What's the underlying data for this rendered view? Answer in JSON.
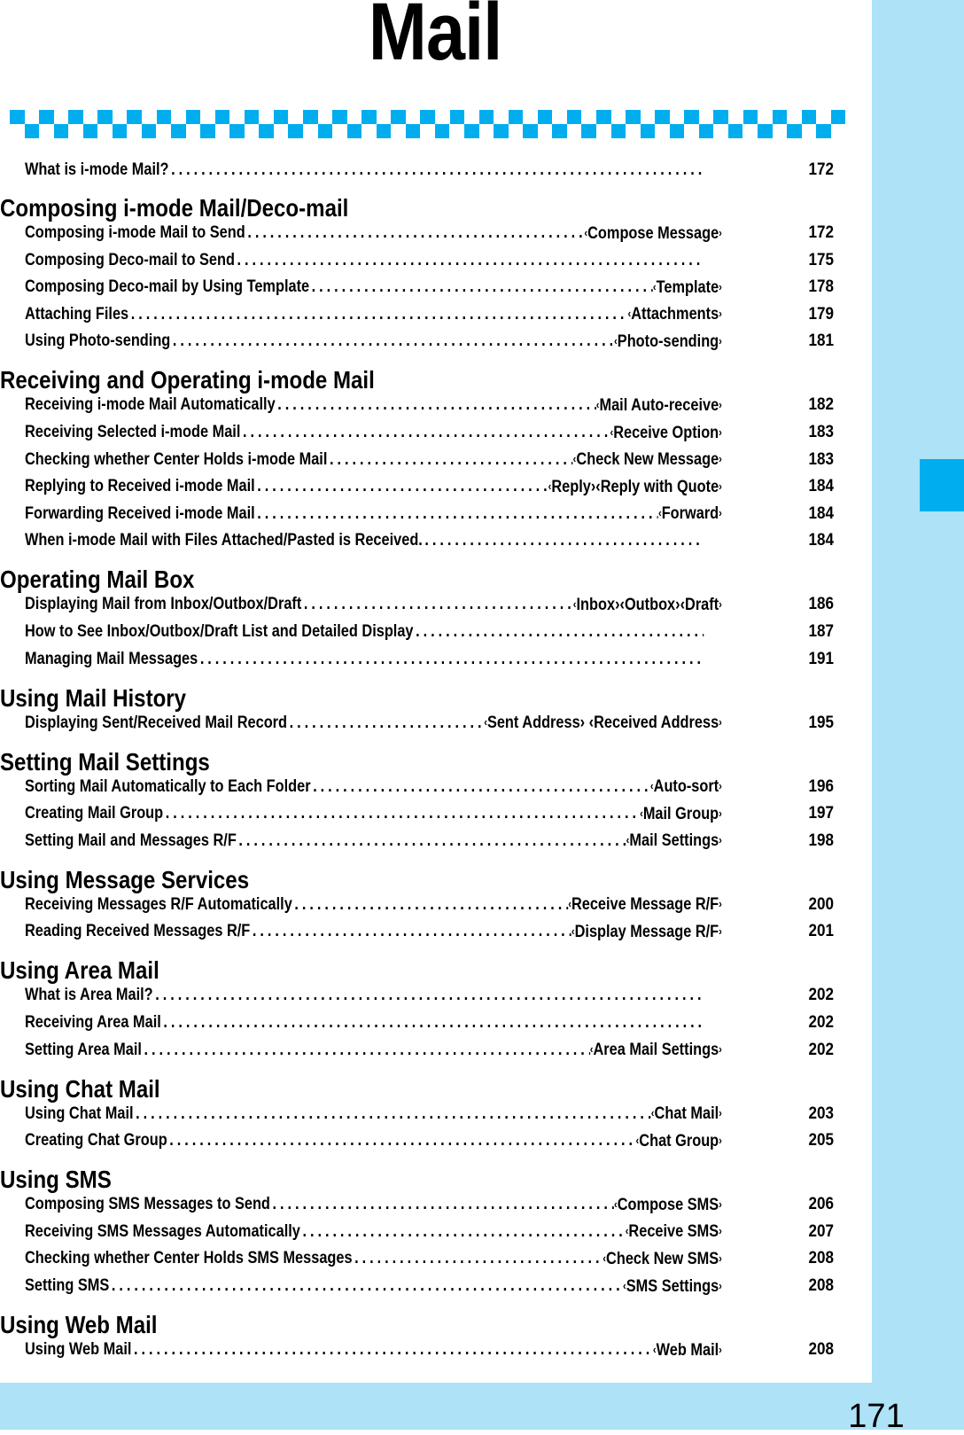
{
  "page": {
    "title": "Mail",
    "page_number": "171",
    "colors": {
      "accent": "#00adef",
      "sidebar": "#ade2f7",
      "text": "#000000"
    }
  },
  "intro": [
    {
      "label": "What is i-mode Mail?",
      "tag": "",
      "page": "172"
    }
  ],
  "sections": [
    {
      "heading": "Composing i-mode Mail/Deco-mail",
      "entries": [
        {
          "label": "Composing i-mode Mail to Send",
          "tag": "Compose Message",
          "page": "172"
        },
        {
          "label": "Composing Deco-mail to Send",
          "tag": "",
          "page": "175"
        },
        {
          "label": "Composing Deco-mail by Using Template",
          "tag": "Template",
          "page": "178"
        },
        {
          "label": "Attaching Files",
          "tag": "Attachments",
          "page": "179"
        },
        {
          "label": "Using Photo-sending",
          "tag": "Photo-sending",
          "page": "181"
        }
      ]
    },
    {
      "heading": "Receiving and Operating i-mode Mail",
      "entries": [
        {
          "label": "Receiving i-mode Mail Automatically",
          "tag": "Mail Auto-receive",
          "page": "182"
        },
        {
          "label": "Receiving Selected i-mode Mail",
          "tag": "Receive Option",
          "page": "183"
        },
        {
          "label": "Checking whether Center Holds i-mode Mail",
          "tag": "Check New Message",
          "page": "183"
        },
        {
          "label": "Replying to Received i-mode Mail",
          "tag": "Reply›‹Reply with Quote",
          "page": "184"
        },
        {
          "label": "Forwarding Received i-mode Mail",
          "tag": "Forward",
          "page": "184"
        },
        {
          "label": "When i-mode Mail with Files Attached/Pasted is Received.",
          "tag": "",
          "page": "184"
        }
      ]
    },
    {
      "heading": "Operating Mail Box",
      "entries": [
        {
          "label": "Displaying Mail from Inbox/Outbox/Draft",
          "tag": "Inbox›‹Outbox›‹Draft",
          "page": "186"
        },
        {
          "label": "How to See Inbox/Outbox/Draft List and Detailed Display",
          "tag": "",
          "page": "187"
        },
        {
          "label": "Managing Mail Messages",
          "tag": "",
          "page": "191"
        }
      ]
    },
    {
      "heading": "Using Mail History",
      "entries": [
        {
          "label": "Displaying Sent/Received Mail Record",
          "tag": "Sent Address› ‹Received Address",
          "page": "195"
        }
      ]
    },
    {
      "heading": "Setting Mail Settings",
      "entries": [
        {
          "label": "Sorting Mail Automatically to Each Folder",
          "tag": "Auto-sort",
          "page": "196"
        },
        {
          "label": "Creating Mail Group",
          "tag": "Mail Group",
          "page": "197"
        },
        {
          "label": "Setting Mail and Messages R/F",
          "tag": "Mail Settings",
          "page": "198"
        }
      ]
    },
    {
      "heading": "Using Message Services",
      "entries": [
        {
          "label": "Receiving Messages R/F Automatically",
          "tag": "Receive Message R/F",
          "page": "200"
        },
        {
          "label": "Reading Received Messages R/F",
          "tag": "Display Message R/F",
          "page": "201"
        }
      ]
    },
    {
      "heading": "Using Area Mail",
      "entries": [
        {
          "label": "What is Area Mail?",
          "tag": "",
          "page": "202"
        },
        {
          "label": "Receiving Area Mail",
          "tag": "",
          "page": "202"
        },
        {
          "label": "Setting Area Mail",
          "tag": "Area Mail Settings",
          "page": "202"
        }
      ]
    },
    {
      "heading": "Using Chat Mail",
      "entries": [
        {
          "label": "Using Chat Mail",
          "tag": "Chat Mail",
          "page": "203"
        },
        {
          "label": "Creating Chat Group",
          "tag": "Chat Group",
          "page": "205"
        }
      ]
    },
    {
      "heading": "Using SMS",
      "entries": [
        {
          "label": "Composing SMS Messages to Send",
          "tag": "Compose SMS",
          "page": "206"
        },
        {
          "label": "Receiving SMS Messages Automatically",
          "tag": "Receive SMS",
          "page": "207"
        },
        {
          "label": "Checking whether Center Holds SMS Messages",
          "tag": "Check New SMS",
          "page": "208"
        },
        {
          "label": "Setting SMS",
          "tag": "SMS Settings",
          "page": "208"
        }
      ]
    },
    {
      "heading": "Using Web Mail",
      "entries": [
        {
          "label": "Using Web Mail",
          "tag": "Web Mail",
          "page": "208"
        }
      ]
    }
  ]
}
